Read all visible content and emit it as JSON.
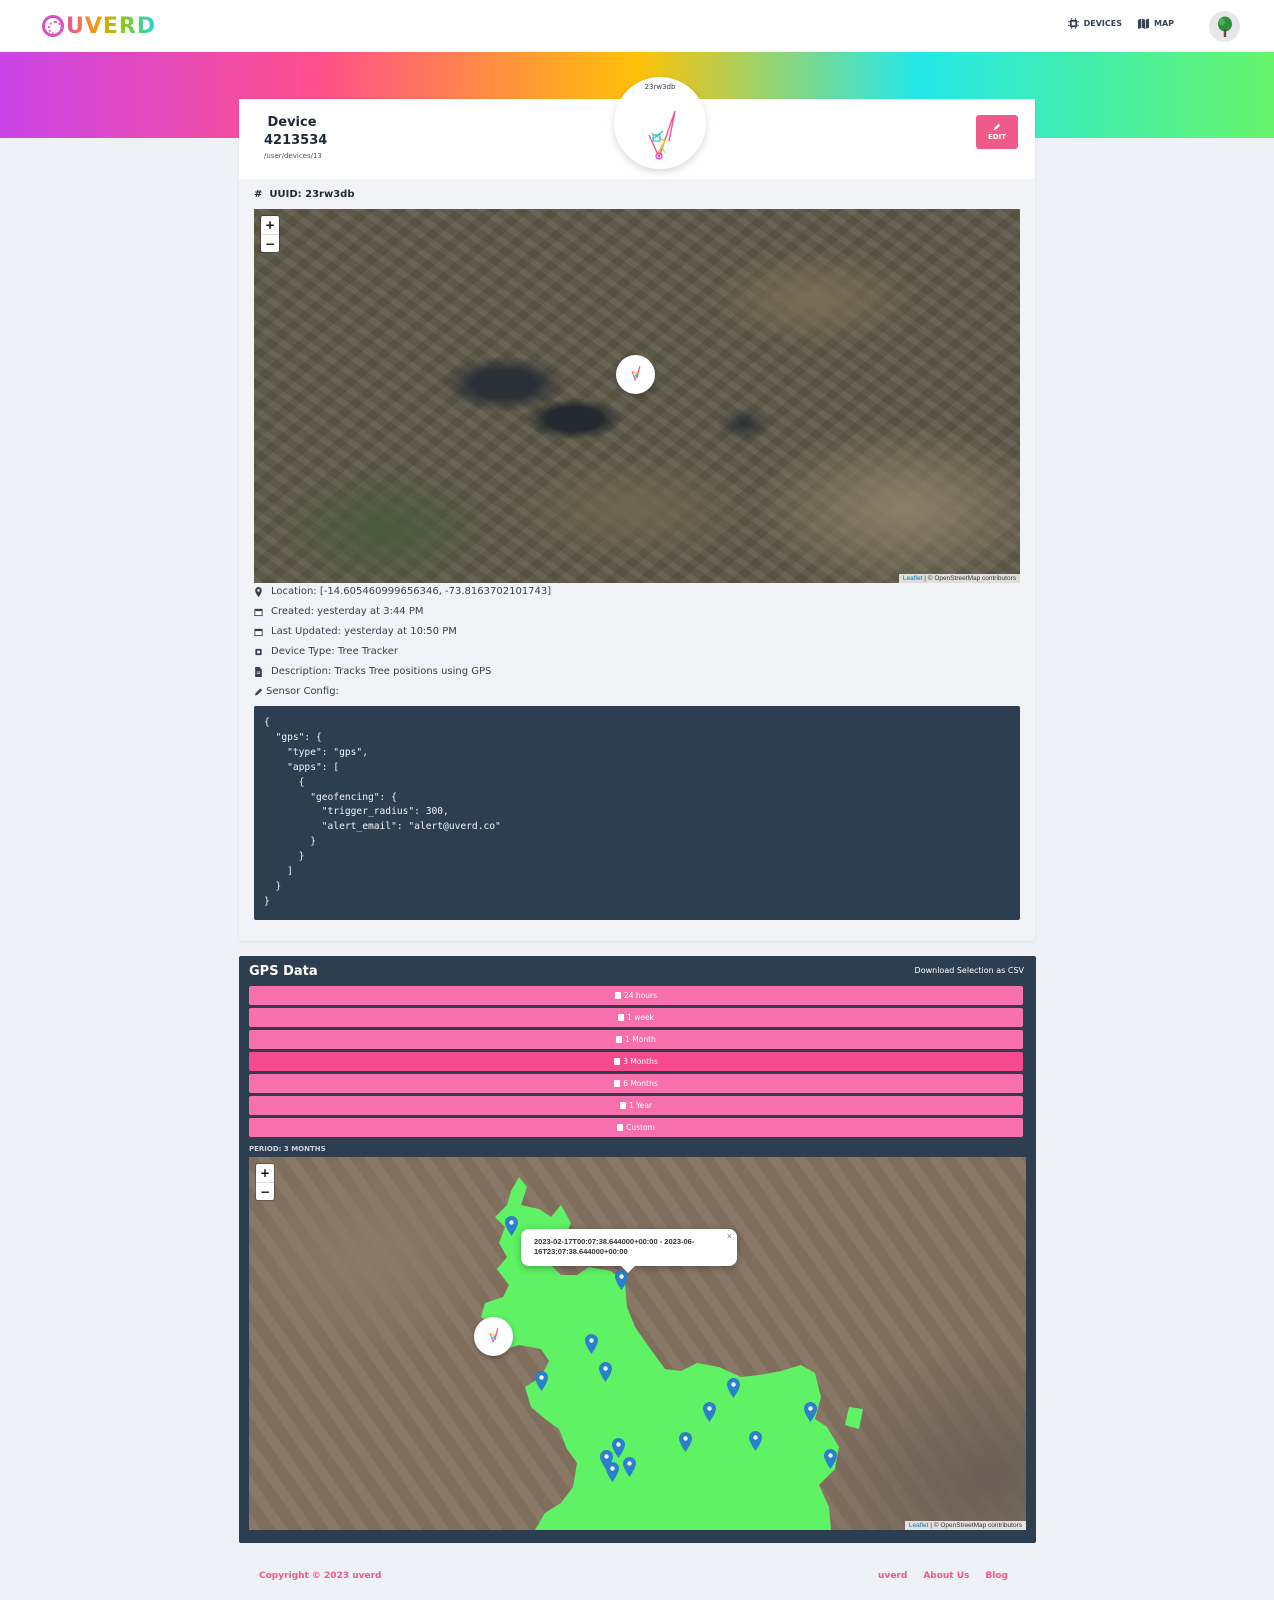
{
  "header": {
    "logo_text": "UVERD",
    "nav": [
      {
        "label": "DEVICES",
        "icon": "chip-icon"
      },
      {
        "label": "MAP",
        "icon": "map-icon"
      }
    ],
    "avatar_icon": "tree-icon"
  },
  "device": {
    "title_line1": "Device",
    "title_line2": "4213534",
    "path": "/user/devices/13",
    "bubble_label": "23rw3db",
    "edit_label": "EDIT",
    "uuid": "UUID: 23rw3db",
    "map_zoom_in": "+",
    "map_zoom_out": "−",
    "attribution_link": "Leaflet",
    "attribution_text": " | © OpenStreetMap contributors",
    "info": {
      "location": "Location: [-14.605460999656346, -73.8163702101743]",
      "created": "Created: yesterday at 3:44 PM",
      "updated": "Last Updated: yesterday at 10:50 PM",
      "type": "Device Type: Tree Tracker",
      "description": "Description: Tracks Tree positions using GPS",
      "sensor_config": "Sensor Config:"
    },
    "sensor_config_json": "{\n  \"gps\": {\n    \"type\": \"gps\",\n    \"apps\": [\n      {\n        \"geofencing\": {\n          \"trigger_radius\": 300,\n          \"alert_email\": \"alert@uverd.co\"\n        }\n      }\n    ]\n  }\n}"
  },
  "gps": {
    "title": "GPS Data",
    "download_label": "Download Selection as CSV",
    "ranges": [
      "24 hours",
      "1 week",
      "1 Month",
      "3 Months",
      "6 Months",
      "1 Year",
      "Custom"
    ],
    "active_range": "3 Months",
    "period_label": "PERIOD: 3 MONTHS",
    "popup_text_line1": "2023-02-17T00:07:38.644000+00:00 - 2023-06-",
    "popup_text_line2": "16T23:07:38.644000+00:00",
    "popup_close": "×",
    "map_zoom_in": "+",
    "map_zoom_out": "−",
    "attribution_link": "Leaflet",
    "attribution_text": " | © OpenStreetMap contributors",
    "trail_color": "#5ef264",
    "pin_color": "#2a81cb"
  },
  "footer": {
    "copyright": "Copyright © 2023 uverd",
    "links": [
      "uverd",
      "About Us",
      "Blog"
    ]
  },
  "colors": {
    "accent": "#ef5a8a",
    "panel_dark": "#2e3e51"
  }
}
